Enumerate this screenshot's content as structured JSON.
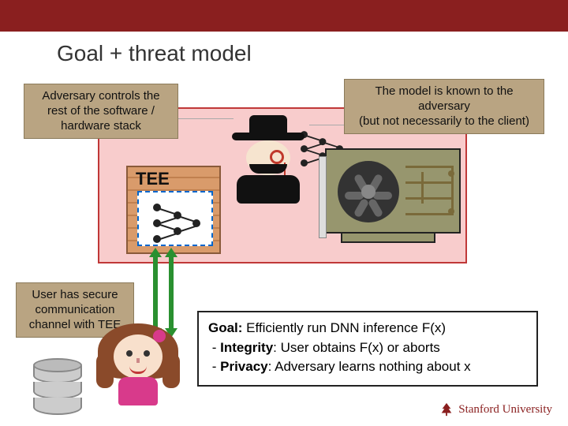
{
  "slide": {
    "title": "Goal + threat model"
  },
  "labels": {
    "adversary": "Adversary controls the rest of the software / hardware stack",
    "model_known": "The model is known to the adversary\n(but not necessarily to the client)",
    "user_channel": "User has secure communication channel with TEE",
    "tee": "TEE"
  },
  "goal": {
    "heading": "Goal:",
    "heading_rest": " Efficiently run DNN inference F(x)",
    "line2_label": "Integrity",
    "line2_rest": ": User obtains F(x) or aborts",
    "line3_label": "Privacy",
    "line3_rest": ": Adversary learns nothing about x"
  },
  "footer": {
    "org": "Stanford University"
  }
}
